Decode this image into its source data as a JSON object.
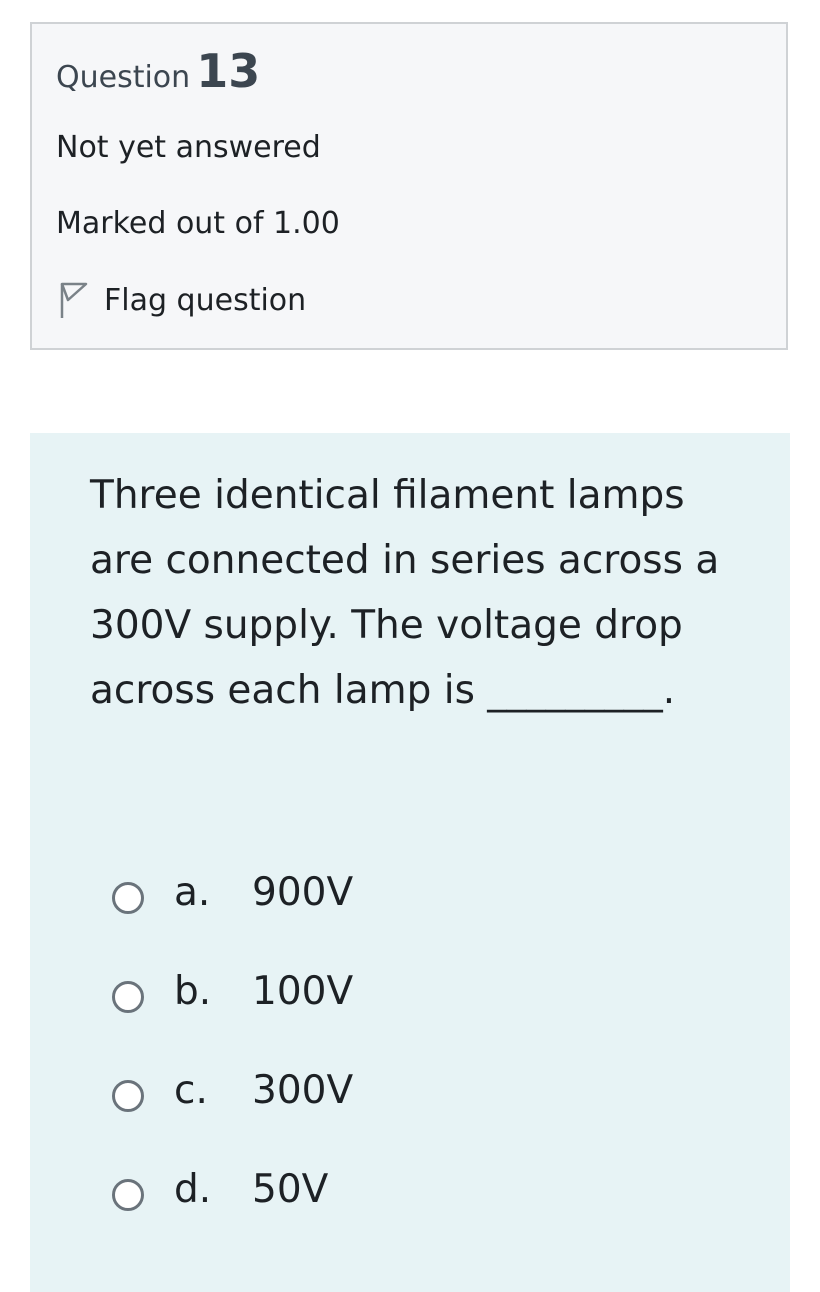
{
  "question_info": {
    "label": "Question",
    "number": "13",
    "state": "Not yet answered",
    "grade": "Marked out of 1.00",
    "flag_label": "Flag question",
    "flag_icon": "flag-outline-icon"
  },
  "question": {
    "text": "Three identical filament lamps are connected in series across a 300V supply. The voltage drop across each lamp is _________.",
    "answers": [
      {
        "letter": "a.",
        "text": "900V",
        "selected": false
      },
      {
        "letter": "b.",
        "text": "100V",
        "selected": false
      },
      {
        "letter": "c.",
        "text": "300V",
        "selected": false
      },
      {
        "letter": "d.",
        "text": "50V",
        "selected": false
      }
    ]
  },
  "colors": {
    "info_background": "#f6f7f9",
    "info_border": "#cfd2d5",
    "content_background": "#e7f3f5",
    "heading_text": "#3c4650",
    "radio_border": "#6a737b"
  }
}
